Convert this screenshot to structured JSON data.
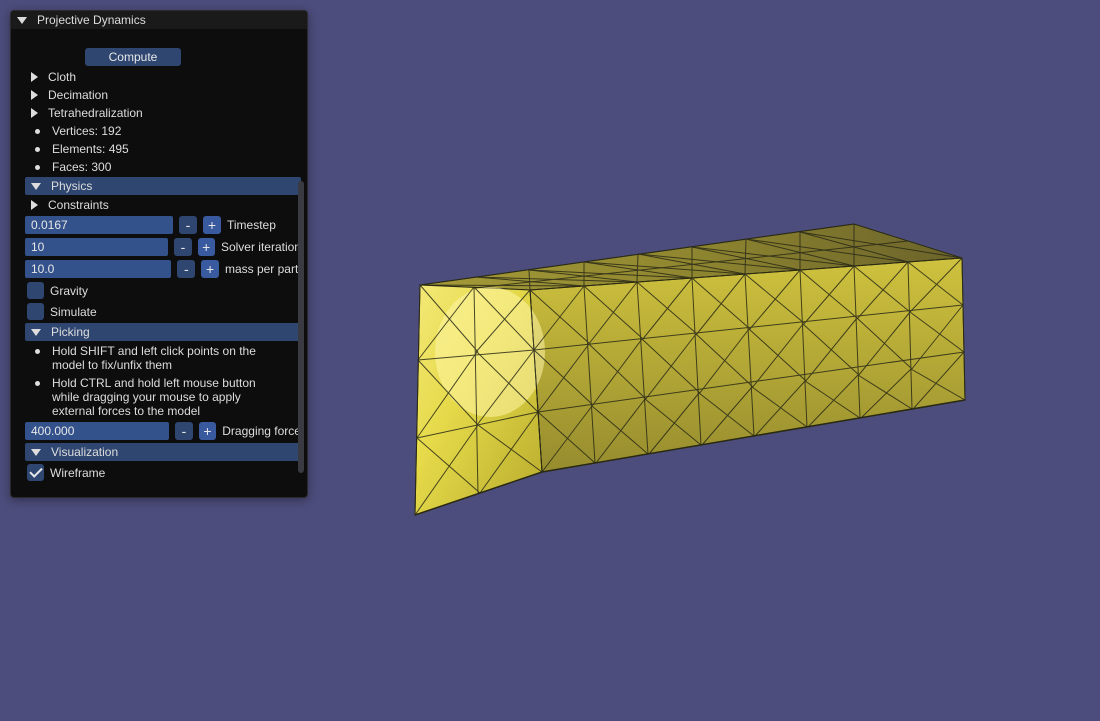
{
  "viewport": {
    "bg": "#4d4d7d"
  },
  "panel": {
    "title": "Projective Dynamics",
    "compute_button": "Compute",
    "tree": {
      "cloth": "Cloth",
      "decimation": "Decimation",
      "tet": "Tetrahedralization",
      "vertices": "Vertices: 192",
      "elements": "Elements: 495",
      "faces": "Faces: 300"
    },
    "physics": {
      "label": "Physics",
      "constraints": "Constraints",
      "timestep_value": "0.0167",
      "timestep_label": "Timestep",
      "solver_iter_value": "10",
      "solver_iter_label": "Solver iteration",
      "mass_value": "10.0",
      "mass_label": "mass per parti",
      "gravity": "Gravity",
      "simulate": "Simulate"
    },
    "picking": {
      "label": "Picking",
      "help1": "Hold SHIFT and left click points on the model to fix/unfix them",
      "help2": "Hold CTRL and hold left mouse button while dragging your mouse to apply external forces to the model",
      "drag_value": "400.000",
      "drag_label": "Dragging force"
    },
    "viz": {
      "label": "Visualization",
      "wireframe": "Wireframe"
    }
  }
}
